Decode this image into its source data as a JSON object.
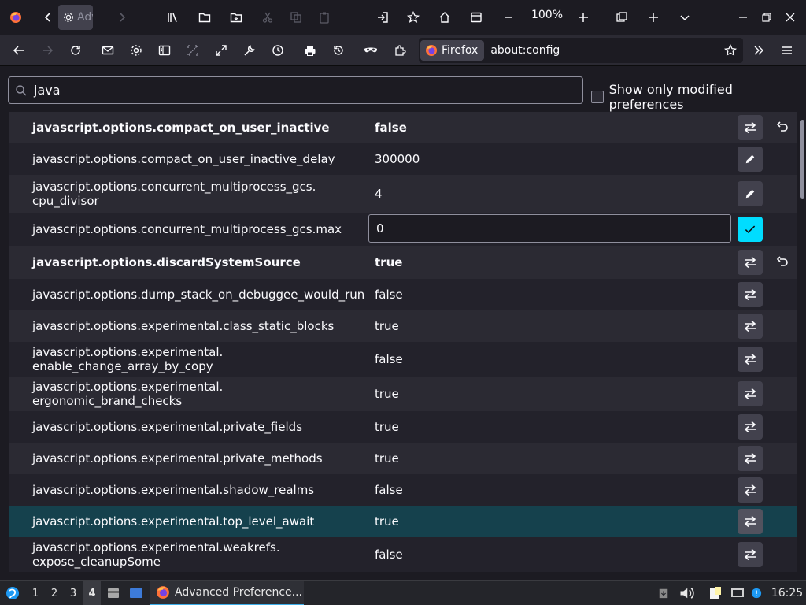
{
  "window": {
    "tab_title": "Advanced Preferences",
    "zoom": "100%"
  },
  "navbar": {
    "identity_label": "Firefox",
    "url": "about:config"
  },
  "config": {
    "search_value": "java",
    "modified_label": "Show only modified preferences",
    "rows": [
      {
        "name": "javascript.options.compact_on_user_inactive",
        "value": "false",
        "modified": true,
        "action": "toggle"
      },
      {
        "name": "javascript.options.compact_on_user_inactive_delay",
        "value": "300000",
        "modified": false,
        "action": "edit"
      },
      {
        "name": "javascript.options.concurrent_multiprocess_gcs.\ncpu_divisor",
        "value": "4",
        "modified": false,
        "action": "edit"
      },
      {
        "name": "javascript.options.concurrent_multiprocess_gcs.max",
        "value": "0",
        "modified": false,
        "action": "save",
        "editing": true
      },
      {
        "name": "javascript.options.discardSystemSource",
        "value": "true",
        "modified": true,
        "action": "toggle"
      },
      {
        "name": "javascript.options.dump_stack_on_debuggee_would_run",
        "value": "false",
        "modified": false,
        "action": "toggle"
      },
      {
        "name": "javascript.options.experimental.class_static_blocks",
        "value": "true",
        "modified": false,
        "action": "toggle"
      },
      {
        "name": "javascript.options.experimental.\nenable_change_array_by_copy",
        "value": "false",
        "modified": false,
        "action": "toggle"
      },
      {
        "name": "javascript.options.experimental.\nergonomic_brand_checks",
        "value": "true",
        "modified": false,
        "action": "toggle"
      },
      {
        "name": "javascript.options.experimental.private_fields",
        "value": "true",
        "modified": false,
        "action": "toggle"
      },
      {
        "name": "javascript.options.experimental.private_methods",
        "value": "true",
        "modified": false,
        "action": "toggle"
      },
      {
        "name": "javascript.options.experimental.shadow_realms",
        "value": "false",
        "modified": false,
        "action": "toggle"
      },
      {
        "name": "javascript.options.experimental.top_level_await",
        "value": "true",
        "modified": false,
        "action": "toggle",
        "highlighted": true
      },
      {
        "name": "javascript.options.experimental.weakrefs.\nexpose_cleanupSome",
        "value": "false",
        "modified": false,
        "action": "toggle"
      }
    ]
  },
  "taskbar": {
    "workspaces": [
      "1",
      "2",
      "3",
      "4"
    ],
    "active_workspace": "4",
    "task_label": "Advanced Preference...",
    "clock": "16:25"
  },
  "colors": {
    "accent": "#00ddff",
    "highlight_row": "#15414d",
    "taskbar_accent": "#3daee9"
  }
}
